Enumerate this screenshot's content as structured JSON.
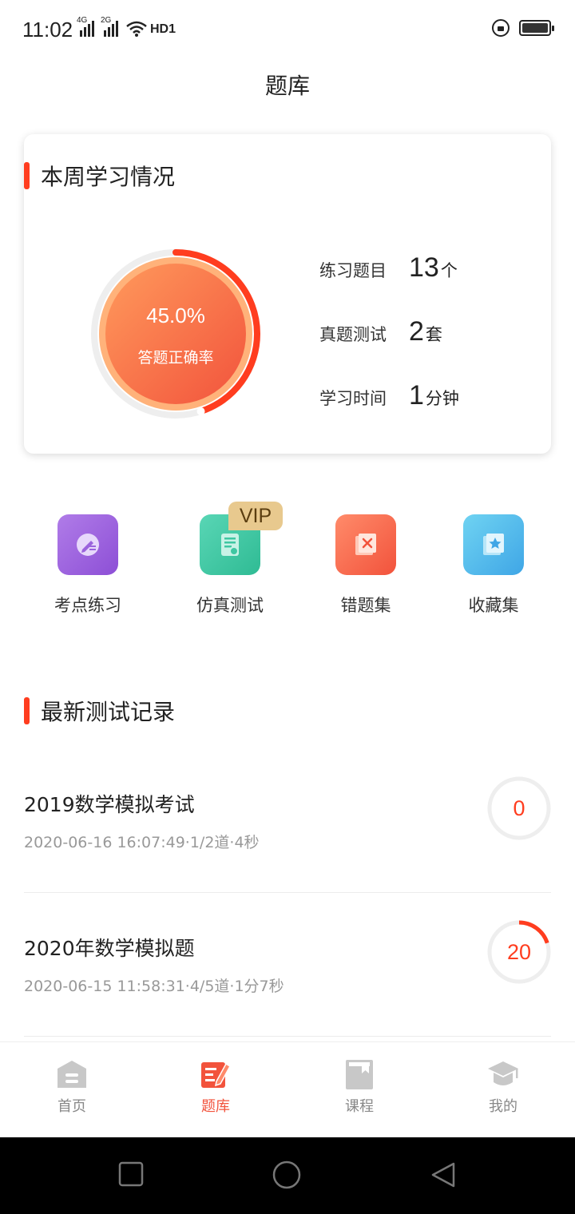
{
  "status_bar": {
    "time": "11:02",
    "network_1": "4G",
    "network_2": "2G",
    "hd_label": "HD1"
  },
  "header": {
    "title": "题库"
  },
  "weekly": {
    "title": "本周学习情况",
    "accuracy": {
      "value_text": "45.0%",
      "label": "答题正确率",
      "fraction": 0.45
    },
    "stats": [
      {
        "label": "练习题目",
        "value": "13",
        "unit": "个"
      },
      {
        "label": "真题测试",
        "value": "2",
        "unit": "套"
      },
      {
        "label": "学习时间",
        "value": "1",
        "unit": "分钟"
      }
    ]
  },
  "actions": [
    {
      "label": "考点练习",
      "icon": "pencil-icon",
      "color": "#9b63dd"
    },
    {
      "label": "仿真测试",
      "icon": "exam-certificate-icon",
      "color": "#3fc7a2",
      "badge": "VIP"
    },
    {
      "label": "错题集",
      "icon": "wrong-mark-icon",
      "color": "#f7664a"
    },
    {
      "label": "收藏集",
      "icon": "star-bookmark-icon",
      "color": "#4bb6ea"
    }
  ],
  "records": {
    "title": "最新测试记录",
    "items": [
      {
        "title": "2019数学模拟考试",
        "meta": "2020-06-16 16:07:49·1/2道·4秒",
        "score": "0",
        "score_fraction": 0.0
      },
      {
        "title": "2020年数学模拟题",
        "meta": "2020-06-15 11:58:31·4/5道·1分7秒",
        "score": "20",
        "score_fraction": 0.2
      }
    ]
  },
  "bottom_nav": {
    "items": [
      {
        "label": "首页",
        "icon": "home-icon",
        "active": false
      },
      {
        "label": "题库",
        "icon": "question-bank-icon",
        "active": true
      },
      {
        "label": "课程",
        "icon": "course-book-icon",
        "active": false
      },
      {
        "label": "我的",
        "icon": "graduation-cap-icon",
        "active": false
      }
    ]
  },
  "colors": {
    "accent": "#ff3d1f",
    "active_tab": "#f2533c",
    "inactive_icon": "#c8c8c8"
  }
}
